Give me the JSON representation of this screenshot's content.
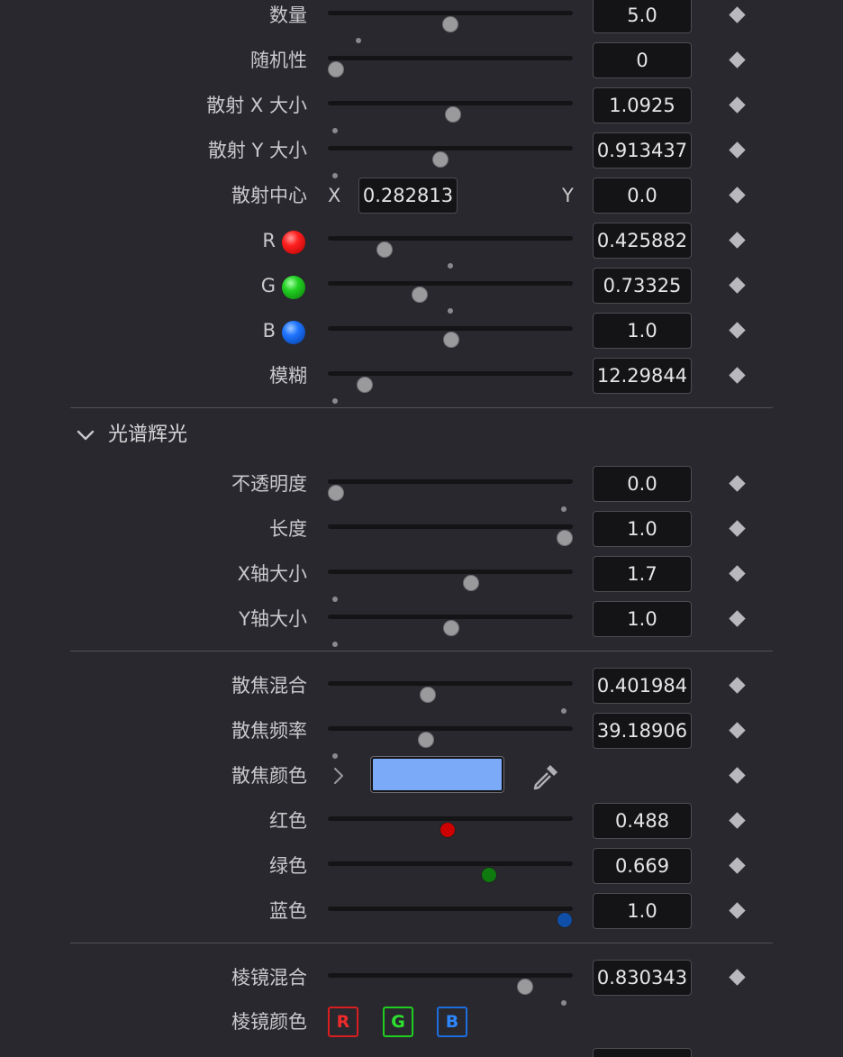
{
  "params": [
    {
      "label": "数量",
      "value": "5.0"
    },
    {
      "label": "随机性",
      "value": "0"
    },
    {
      "label": "散射 X 大小",
      "value": "1.0925"
    },
    {
      "label": "散射 Y 大小",
      "value": "0.913437"
    },
    {
      "label": "散射中心",
      "x_label": "X",
      "x_value": "0.282813",
      "y_label": "Y",
      "y_value": "0.0"
    },
    {
      "label": "R",
      "value": "0.425882"
    },
    {
      "label": "G",
      "value": "0.73325"
    },
    {
      "label": "B",
      "value": "1.0"
    },
    {
      "label": "模糊",
      "value": "12.29844"
    }
  ],
  "section": {
    "title": "光谱辉光"
  },
  "spectrum": [
    {
      "label": "不透明度",
      "value": "0.0"
    },
    {
      "label": "长度",
      "value": "1.0"
    },
    {
      "label": "X轴大小",
      "value": "1.7"
    },
    {
      "label": "Y轴大小",
      "value": "1.0"
    }
  ],
  "bokeh": [
    {
      "label": "散焦混合",
      "value": "0.401984"
    },
    {
      "label": "散焦频率",
      "value": "39.18906"
    },
    {
      "label": "散焦颜色",
      "swatch": "#7aaaf8"
    },
    {
      "label": "红色",
      "value": "0.488",
      "knob_color": "#cc0000"
    },
    {
      "label": "绿色",
      "value": "0.669",
      "knob_color": "#0f7a0f"
    },
    {
      "label": "蓝色",
      "value": "1.0",
      "knob_color": "#0f4fa8"
    }
  ],
  "prism": {
    "mix": {
      "label": "棱镜混合",
      "value": "0.830343"
    },
    "color": {
      "label": "棱镜颜色",
      "r": "R",
      "g": "G",
      "b": "B"
    }
  }
}
